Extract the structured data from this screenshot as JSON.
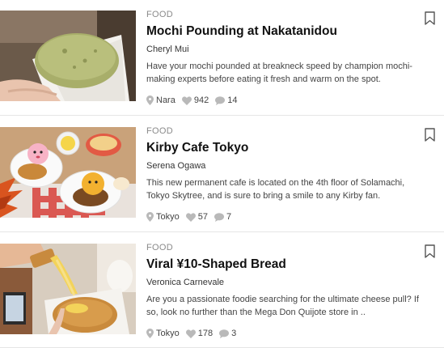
{
  "articles": [
    {
      "category": "FOOD",
      "title": "Mochi Pounding at Nakatanidou",
      "author": "Cheryl Mui",
      "excerpt": "Have your mochi pounded at breakneck speed by champion mochi-making experts before eating it fresh and warm on the spot.",
      "location": "Nara",
      "likes": "942",
      "comments": "14",
      "image_icon": "mochi-photo"
    },
    {
      "category": "FOOD",
      "title": "Kirby Cafe Tokyo",
      "author": "Serena Ogawa",
      "excerpt": "This new permanent cafe is located on the 4th floor of Solamachi, Tokyo Skytree, and is sure to bring a smile to any Kirby fan.",
      "location": "Tokyo",
      "likes": "57",
      "comments": "7",
      "image_icon": "kirby-cafe-photo"
    },
    {
      "category": "FOOD",
      "title": "Viral ¥10-Shaped Bread",
      "author": "Veronica Carnevale",
      "excerpt": "Are you a passionate foodie searching for the ultimate cheese pull? If so, look no further than the Mega Don Quijote store in ..",
      "location": "Tokyo",
      "likes": "178",
      "comments": "3",
      "image_icon": "cheese-bread-photo"
    }
  ],
  "colors": {
    "meta_icon": "#b9b9b9",
    "category": "#8a8a8a",
    "title": "#111111",
    "divider": "#e6e6e6"
  }
}
